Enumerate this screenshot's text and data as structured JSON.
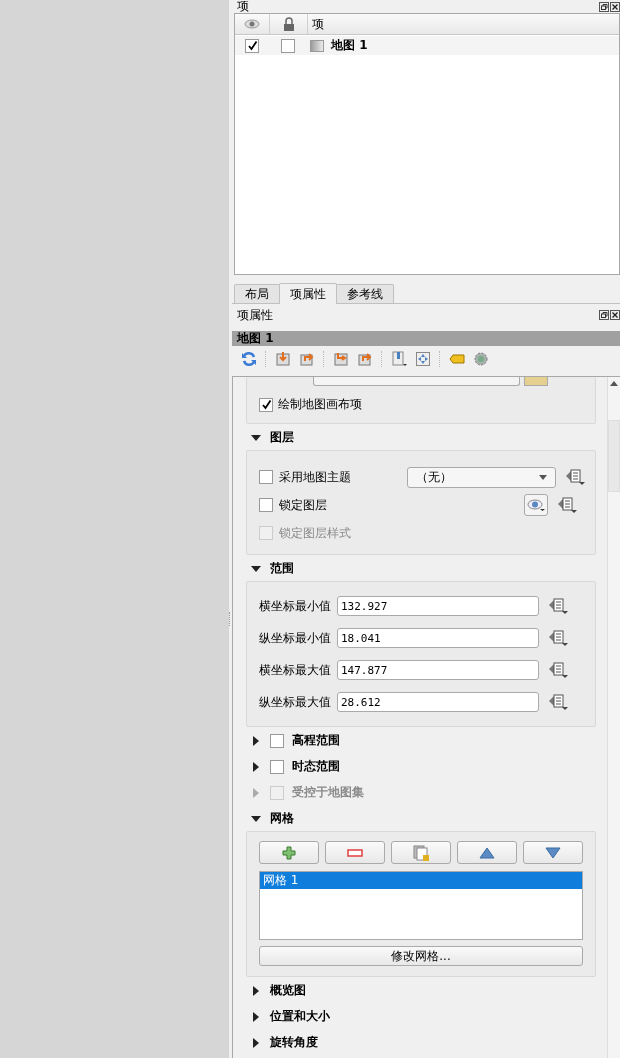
{
  "items_panel": {
    "title": "项",
    "columns": [
      {
        "kind": "eye"
      },
      {
        "kind": "lock"
      },
      {
        "kind": "text",
        "label": "项"
      }
    ],
    "rows": [
      {
        "visible": true,
        "locked": false,
        "name": "地图 1",
        "selected": false
      }
    ]
  },
  "tabs": [
    {
      "label": "布局",
      "selected": false
    },
    {
      "label": "项属性",
      "selected": true
    },
    {
      "label": "参考线",
      "selected": false
    }
  ],
  "properties_panel": {
    "title": "项属性",
    "item_title": "地图 1",
    "draw_items": {
      "label": "绘制地图画布项",
      "checked": true
    },
    "sections": [
      {
        "kind": "layers",
        "title": "图层",
        "expanded": true,
        "rows": [
          {
            "kind": "combo",
            "label": "采用地图主题",
            "checked": false,
            "disabled": false,
            "value": "（无）"
          },
          {
            "kind": "eye",
            "label": "锁定图层",
            "checked": false,
            "disabled": false
          },
          {
            "kind": "plain",
            "label": "锁定图层样式",
            "checked": false,
            "disabled": true
          }
        ]
      },
      {
        "kind": "extent",
        "title": "范围",
        "expanded": true,
        "fields": [
          {
            "label": "横坐标最小值",
            "value": "132.927"
          },
          {
            "label": "纵坐标最小值",
            "value": "18.041"
          },
          {
            "label": "横坐标最大值",
            "value": "147.877"
          },
          {
            "label": "纵坐标最大值",
            "value": "28.612"
          }
        ]
      },
      {
        "kind": "checkable",
        "title": "高程范围",
        "expanded": false,
        "checked": false,
        "disabled": false
      },
      {
        "kind": "checkable",
        "title": "时态范围",
        "expanded": false,
        "checked": false,
        "disabled": false
      },
      {
        "kind": "checkable",
        "title": "受控于地图集",
        "expanded": false,
        "checked": false,
        "disabled": true
      },
      {
        "kind": "grids",
        "title": "网格",
        "expanded": true,
        "items": [
          {
            "label": "网格 1",
            "selected": true
          }
        ],
        "button": "修改网格..."
      },
      {
        "kind": "plain",
        "title": "概览图",
        "expanded": false
      },
      {
        "kind": "plain",
        "title": "位置和大小",
        "expanded": false
      },
      {
        "kind": "plain",
        "title": "旋转角度",
        "expanded": false
      }
    ]
  }
}
